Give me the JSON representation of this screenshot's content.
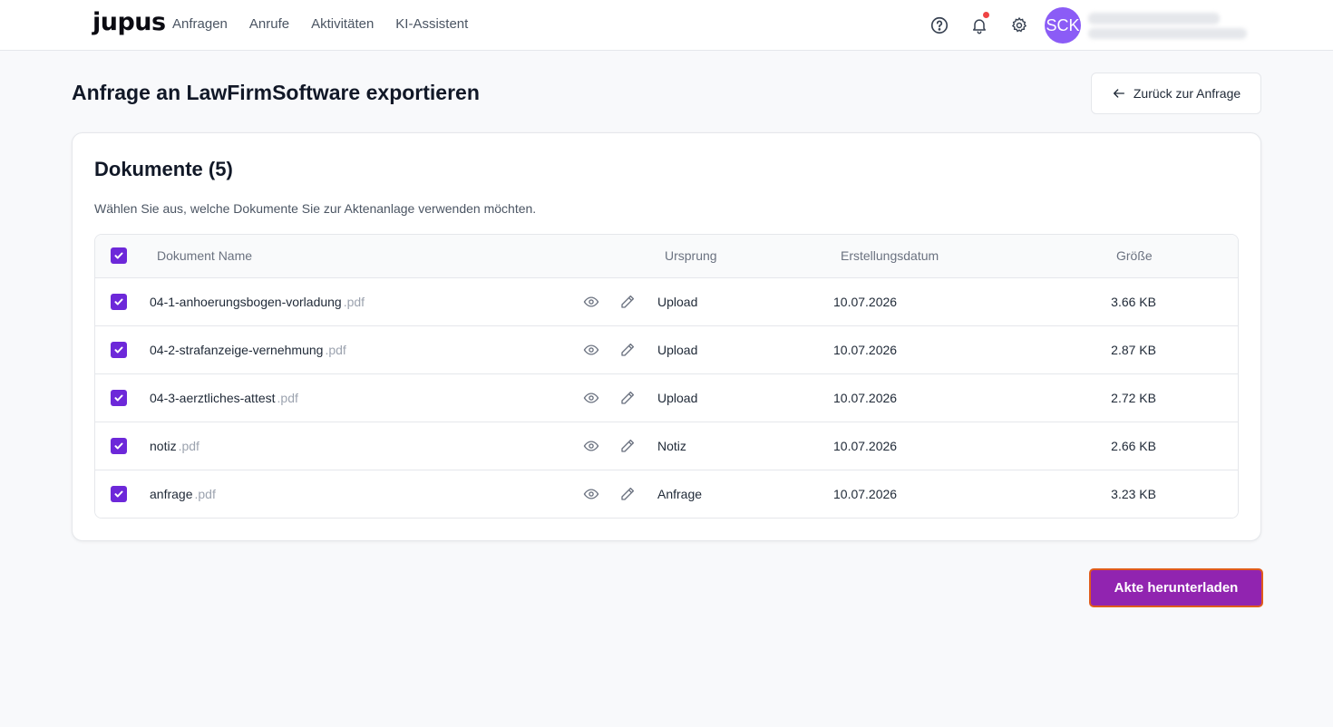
{
  "app": {
    "logo": "jupus",
    "nav": [
      "Anfragen",
      "Anrufe",
      "Aktivitäten",
      "KI-Assistent"
    ],
    "avatar_initials": "SCK",
    "accent_color": "#6d28d9",
    "notification_dot_color": "#ef4444"
  },
  "page": {
    "title": "Anfrage an LawFirmSoftware exportieren",
    "back_label": "Zurück zur Anfrage"
  },
  "card": {
    "title": "Dokumente (5)",
    "subtitle": "Wählen Sie aus, welche Dokumente Sie zur Aktenanlage verwenden möchten.",
    "columns": {
      "name": "Dokument Name",
      "origin": "Ursprung",
      "date": "Erstellungsdatum",
      "size": "Größe"
    },
    "select_all_checked": true,
    "documents": [
      {
        "name": "04-1-anhoerungsbogen-vorladung",
        "ext": ".pdf",
        "origin": "Upload",
        "date": "10.07.2026",
        "size": "3.66 KB",
        "checked": true
      },
      {
        "name": "04-2-strafanzeige-vernehmung",
        "ext": ".pdf",
        "origin": "Upload",
        "date": "10.07.2026",
        "size": "2.87 KB",
        "checked": true
      },
      {
        "name": "04-3-aerztliches-attest",
        "ext": ".pdf",
        "origin": "Upload",
        "date": "10.07.2026",
        "size": "2.72 KB",
        "checked": true
      },
      {
        "name": "notiz",
        "ext": ".pdf",
        "origin": "Notiz",
        "date": "10.07.2026",
        "size": "2.66 KB",
        "checked": true
      },
      {
        "name": "anfrage",
        "ext": ".pdf",
        "origin": "Anfrage",
        "date": "10.07.2026",
        "size": "3.23 KB",
        "checked": true
      }
    ]
  },
  "actions": {
    "download_label": "Akte herunterladen",
    "download_color": "#9124b0"
  }
}
